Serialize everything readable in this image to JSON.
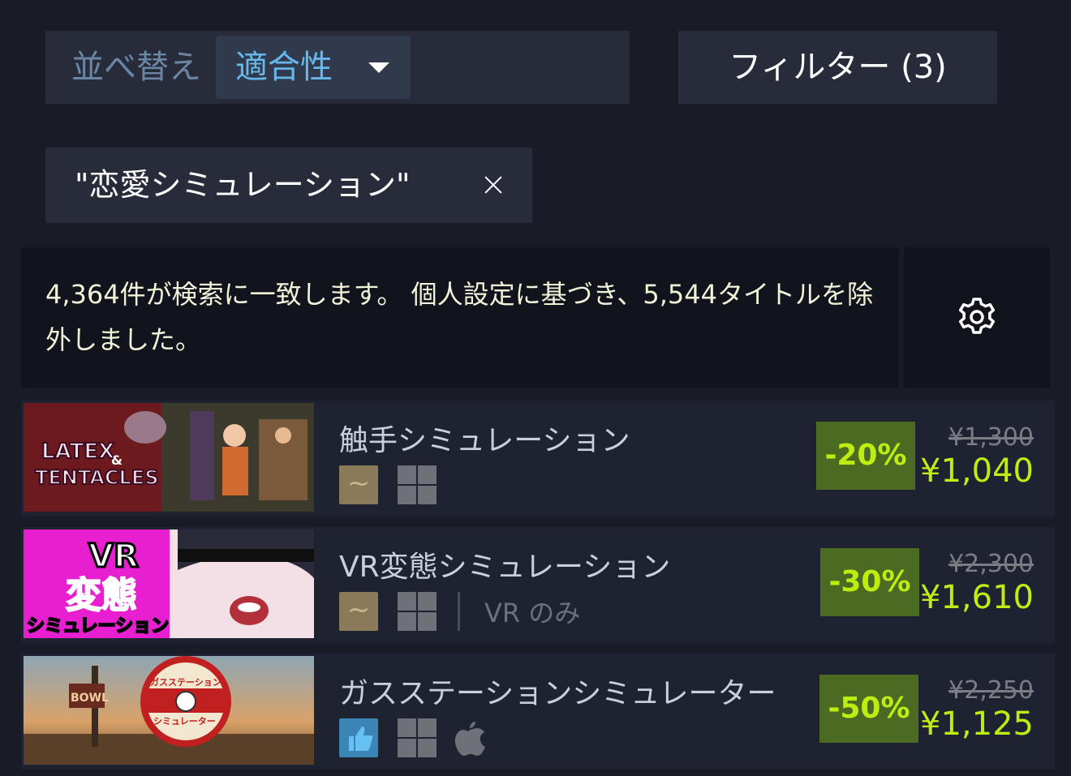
{
  "sort": {
    "label": "並べ替え",
    "value": "適合性"
  },
  "filter": {
    "label": "フィルター (3)"
  },
  "tag": {
    "text": "\"恋愛シミュレーション\""
  },
  "info": {
    "text": "4,364件が検索に一致します。 個人設定に基づき、5,544タイトルを除外しました。"
  },
  "icons": {
    "settings": "gear-icon",
    "windows": "windows-icon",
    "mac": "apple-icon",
    "close": "close-icon"
  },
  "colors": {
    "background": "#191b27",
    "panel": "#272b3a",
    "discount_bg": "#4c6b22",
    "discount_text": "#beee11",
    "accent": "#66b7ea"
  },
  "results": [
    {
      "thumb_text": [
        "LATEX",
        "&",
        "TENTACLES"
      ],
      "title": "触手シミュレーション",
      "review": "mixed",
      "platforms": [
        "windows"
      ],
      "discount": "-20%",
      "original_price": "¥1,300",
      "final_price": "¥1,040"
    },
    {
      "thumb_text": [
        "VR",
        "変態",
        "シミュレーション"
      ],
      "title": "VR変態シミュレーション",
      "review": "mixed",
      "platforms": [
        "windows"
      ],
      "vr_only": "VR のみ",
      "discount": "-30%",
      "original_price": "¥2,300",
      "final_price": "¥1,610"
    },
    {
      "thumb_text": [
        "BOWL",
        "ガスステーション",
        "シミュレーター"
      ],
      "title": "ガスステーションシミュレーター",
      "review": "positive",
      "platforms": [
        "windows",
        "mac"
      ],
      "discount": "-50%",
      "original_price": "¥2,250",
      "final_price": "¥1,125"
    }
  ]
}
